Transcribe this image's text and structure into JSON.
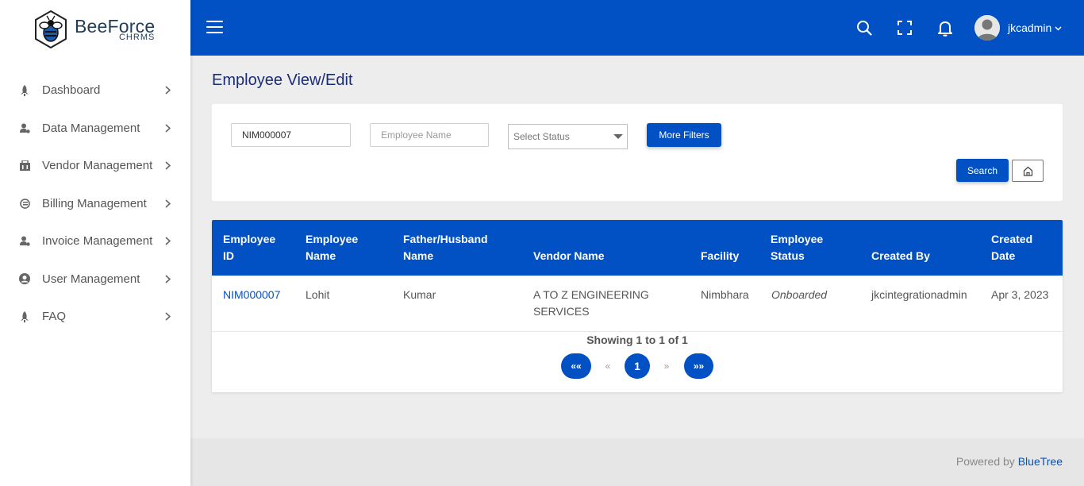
{
  "brand": {
    "name": "BeeForce",
    "sub": "CHRMS"
  },
  "sidebar": {
    "items": [
      {
        "label": "Dashboard",
        "icon": "rocket-icon"
      },
      {
        "label": "Data Management",
        "icon": "user-gear-icon"
      },
      {
        "label": "Vendor Management",
        "icon": "building-icon"
      },
      {
        "label": "Billing Management",
        "icon": "billing-icon"
      },
      {
        "label": "Invoice Management",
        "icon": "user-gear-icon"
      },
      {
        "label": "User Management",
        "icon": "user-circle-icon"
      },
      {
        "label": "FAQ",
        "icon": "rocket-icon"
      }
    ]
  },
  "header": {
    "username": "jkcadmin",
    "icons": [
      "hamburger-icon",
      "search-icon",
      "fullscreen-icon",
      "bell-icon",
      "avatar",
      "chevron-down-icon"
    ]
  },
  "page": {
    "title": "Employee View/Edit"
  },
  "filters": {
    "employee_id_value": "NIM000007",
    "employee_name_placeholder": "Employee Name",
    "status_selected": "Select Status",
    "more_filters_label": "More Filters",
    "search_label": "Search"
  },
  "table": {
    "columns": [
      {
        "line1": "Employee",
        "line2": "ID"
      },
      {
        "line1": "Employee",
        "line2": "Name"
      },
      {
        "line1": "Father/Husband",
        "line2": "Name"
      },
      {
        "line1": "",
        "line2": "Vendor Name"
      },
      {
        "line1": "",
        "line2": "Facility"
      },
      {
        "line1": "Employee",
        "line2": "Status"
      },
      {
        "line1": "",
        "line2": "Created By"
      },
      {
        "line1": "Created",
        "line2": "Date"
      }
    ],
    "rows": [
      {
        "employee_id": "NIM000007",
        "employee_name": "Lohit",
        "father_husband_name": "Kumar",
        "vendor_name_line1": "A TO Z ENGINEERING",
        "vendor_name_line2": "SERVICES",
        "facility": "Nimbhara",
        "status": "Onboarded",
        "created_by": "jkcintegrationadmin",
        "created_date": "Apr 3, 2023"
      }
    ],
    "showing": "Showing 1 to 1 of 1"
  },
  "pagination": {
    "first": "««",
    "prev": "«",
    "current": "1",
    "next": "»",
    "last": "»»"
  },
  "footer": {
    "prefix": "Powered by",
    "link": "BlueTree"
  },
  "colors": {
    "primary": "#0151c4",
    "title": "#1a2c78",
    "sidebar_bg": "#ffffff",
    "page_bg": "#ededed"
  }
}
